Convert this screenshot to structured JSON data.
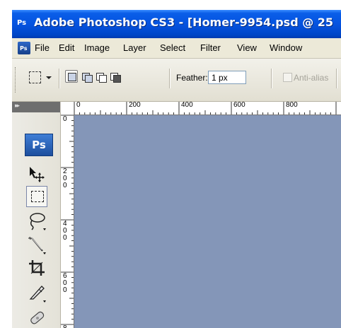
{
  "window": {
    "title": "Adobe Photoshop CS3 - [Homer-9954.psd @ 25",
    "app_badge": "Ps"
  },
  "menubar": {
    "items": [
      {
        "label": "File"
      },
      {
        "label": "Edit"
      },
      {
        "label": "Image"
      },
      {
        "label": "Layer"
      },
      {
        "label": "Select"
      },
      {
        "label": "Filter"
      },
      {
        "label": "View"
      },
      {
        "label": "Window"
      }
    ]
  },
  "options": {
    "feather_label": "Feather:",
    "feather_value": "1 px",
    "antialias_label": "Anti-alias"
  },
  "toolbox": {
    "logo": "Ps",
    "tools": [
      "move-tool",
      "rectangular-marquee-tool",
      "lasso-tool",
      "magic-wand-tool",
      "crop-tool",
      "slice-tool",
      "healing-brush-tool"
    ]
  },
  "rulers": {
    "top_labels": [
      "0",
      "200",
      "400",
      "600",
      "800"
    ],
    "left_labels": [
      "0",
      "200",
      "400",
      "600",
      "8"
    ]
  },
  "colors": {
    "canvas": "#8496b8",
    "titlebar": "#0553e0"
  }
}
